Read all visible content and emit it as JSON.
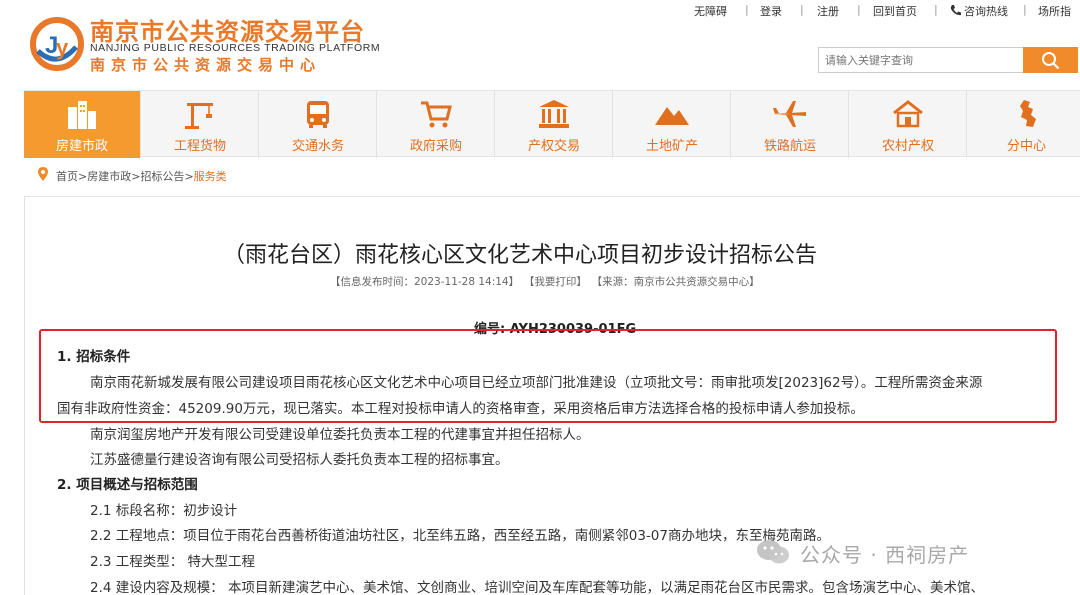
{
  "header": {
    "title": "南京市公共资源交易平台",
    "title_en": "NANJING PUBLIC RESOURCES TRADING PLATFORM",
    "subtitle": "南京市公共资源交易中心",
    "brand_color": "#e8792a"
  },
  "toplinks": {
    "accessible": "无障碍",
    "login": "登录",
    "register": "注册",
    "home": "回到首页",
    "hotline": "咨询热线",
    "venue": "场所指"
  },
  "search": {
    "placeholder": "请输入关键字查询",
    "icon": "search-icon"
  },
  "nav": {
    "items": [
      {
        "label": "房建市政",
        "icon": "buildings-icon",
        "active": true
      },
      {
        "label": "工程货物",
        "icon": "crane-icon"
      },
      {
        "label": "交通水务",
        "icon": "bus-icon"
      },
      {
        "label": "政府采购",
        "icon": "cart-icon"
      },
      {
        "label": "产权交易",
        "icon": "bank-icon"
      },
      {
        "label": "土地矿产",
        "icon": "mountain-icon"
      },
      {
        "label": "铁路航运",
        "icon": "plane-icon"
      },
      {
        "label": "农村产权",
        "icon": "farmhouse-icon"
      },
      {
        "label": "分中心",
        "icon": "jiangsu-map-icon"
      }
    ],
    "active_color": "#f49a2f"
  },
  "breadcrumb": {
    "home": "首页",
    "sep": ">",
    "level1": "房建市政",
    "level2": "招标公告",
    "current": "服务类"
  },
  "article": {
    "title": "（雨花台区）雨花核心区文化艺术中心项目初步设计招标公告",
    "meta_date": "【信息发布时间：2023-11-28 14:14】",
    "meta_print": "【我要打印】",
    "meta_source": "【来源：南京市公共资源交易中心】",
    "code": "编号: AYH230039-01FG",
    "section1_title": "1. 招标条件",
    "section1_p1_line1": "南京雨花新城发展有限公司建设项目雨花核心区文化艺术中心项目已经立项部门批准建设（立项批文号：雨审批项发[2023]62号）。工程所需资金来源",
    "section1_p1_line2": "国有非政府性资金：45209.90万元，现已落实。本工程对投标申请人的资格审查，采用资格后审方法选择合格的投标申请人参加投标。",
    "section1_p2": "南京润玺房地产开发有限公司受建设单位委托负责本工程的代建事宜并担任招标人。",
    "section1_p3": "江苏盛德量行建设咨询有限公司受招标人委托负责本工程的招标事宜。",
    "section2_title": "2. 项目概述与招标范围",
    "item_2_1": "2.1 标段名称：初步设计",
    "item_2_2": "2.2 工程地点：项目位于雨花台西善桥街道油坊社区，北至纬五路，西至经五路，南侧紧邻03-07商办地块，东至梅苑南路。",
    "item_2_3": "2.3 工程类型：  特大型工程",
    "item_2_4": "2.4 建设内容及规模：  本项目新建演艺中心、美术馆、文创商业、培训空间及车库配套等功能，以满足雨花台区市民需求。包含场演艺中心、美术馆、"
  },
  "highlight": {
    "color": "#e0242a"
  },
  "watermark": {
    "text": "公众号 · 西祠房产",
    "icon": "wechat-icon"
  }
}
